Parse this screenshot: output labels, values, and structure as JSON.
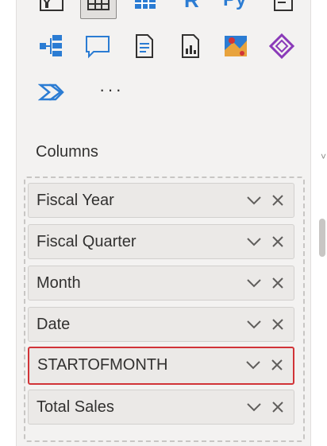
{
  "visualizations": {
    "icons_row1": [
      "funnel-table-icon",
      "table-icon",
      "matrix-icon",
      "r-visual-icon",
      "python-visual-icon",
      "key-influencers-icon"
    ],
    "icons_row2": [
      "decomposition-tree-icon",
      "qna-icon",
      "smart-narrative-icon",
      "paginated-report-icon",
      "azure-map-icon",
      "power-apps-icon"
    ],
    "icons_row3": [
      "power-automate-icon"
    ],
    "more_label": "···"
  },
  "columns": {
    "label": "Columns",
    "fields": [
      {
        "name": "Fiscal Year"
      },
      {
        "name": "Fiscal Quarter"
      },
      {
        "name": "Month"
      },
      {
        "name": "Date"
      },
      {
        "name": "STARTOFMONTH",
        "highlighted": true
      },
      {
        "name": "Total Sales"
      }
    ]
  },
  "colors": {
    "panel_bg": "#f3f2f1",
    "field_bg": "#ebe9e7",
    "highlight": "#d13438",
    "accent_blue": "#2b7cd3"
  }
}
